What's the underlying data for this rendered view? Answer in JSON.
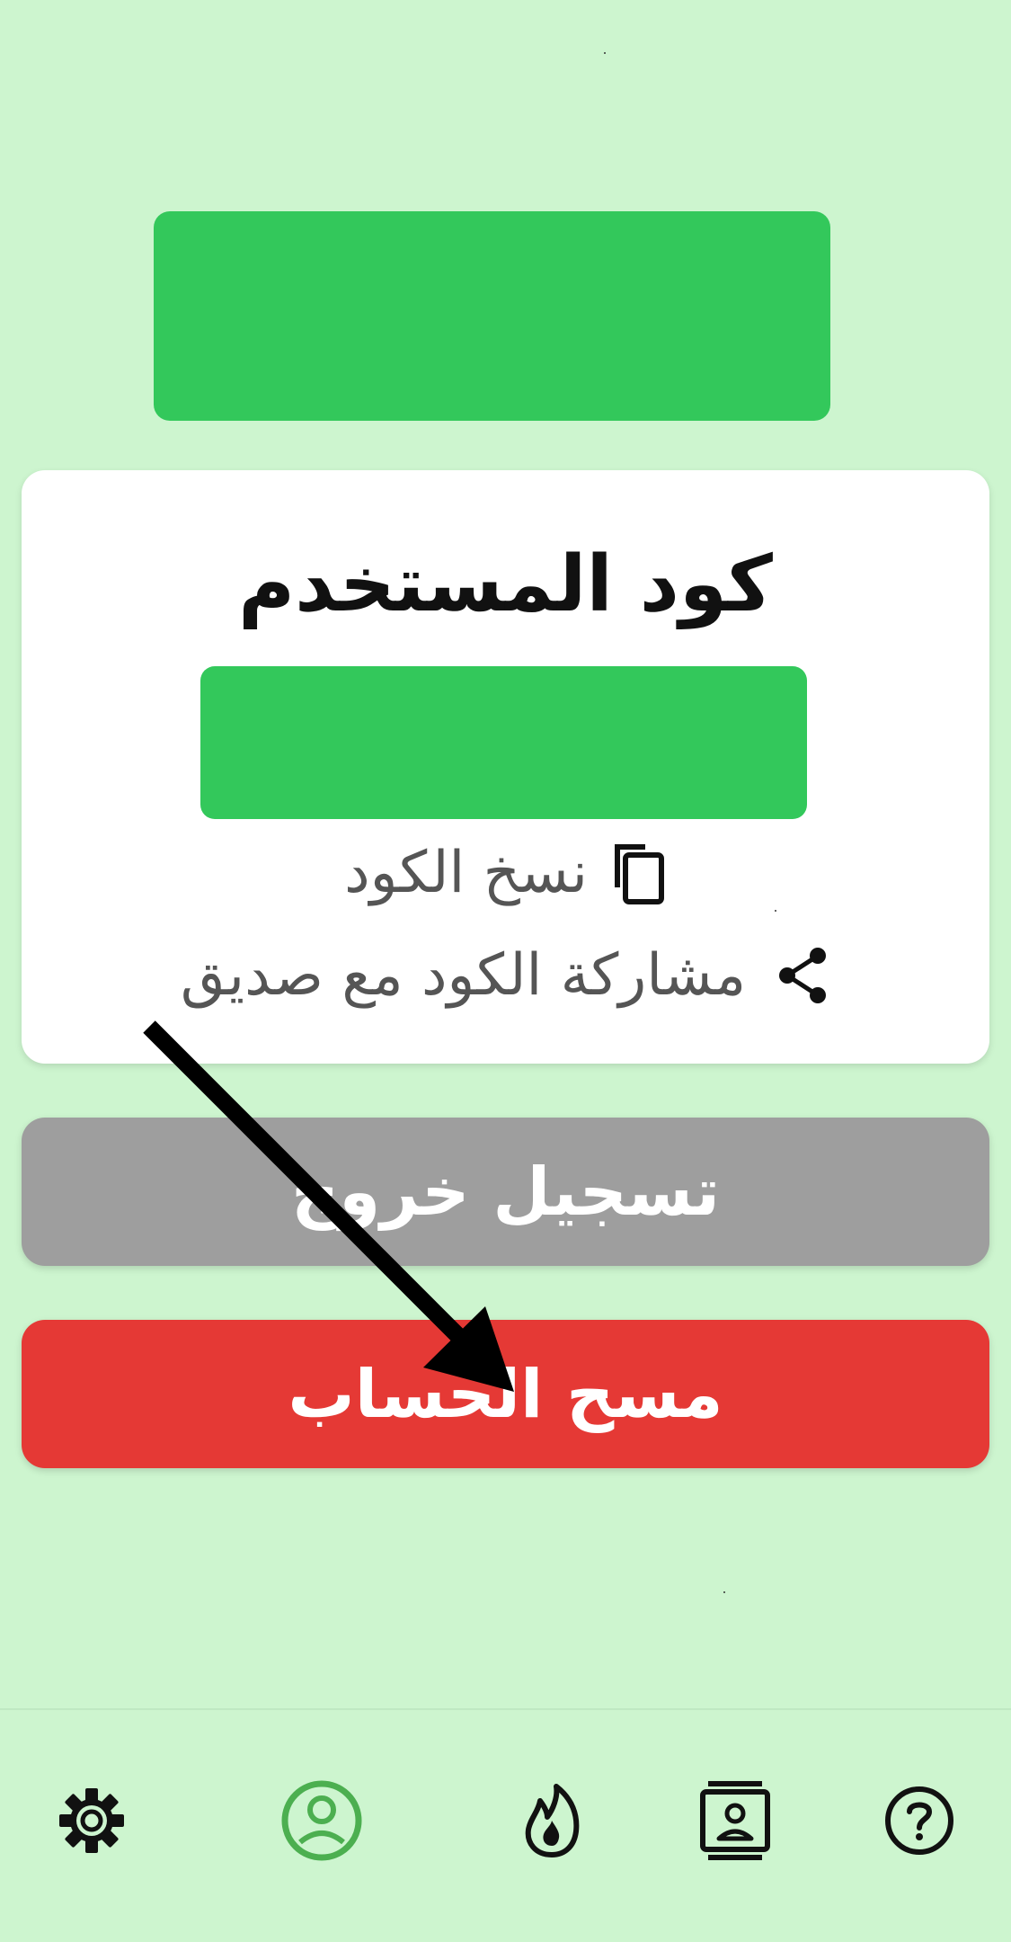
{
  "profile": {
    "user_code_title": "كود المستخدم",
    "copy_code_label": "نسخ الكود",
    "share_code_label": "مشاركة الكود مع صديق"
  },
  "actions": {
    "logout_label": "تسجيل خروج",
    "delete_account_label": "مسح الحساب"
  },
  "bottom_nav": {
    "items": [
      {
        "icon": "help-icon",
        "active": false
      },
      {
        "icon": "contact-card-icon",
        "active": false
      },
      {
        "icon": "flame-icon",
        "active": false
      },
      {
        "icon": "profile-icon",
        "active": true
      },
      {
        "icon": "settings-gear-icon",
        "active": false
      }
    ]
  },
  "colors": {
    "background": "#cdf5cf",
    "brand_green": "#33c85b",
    "logout_gray": "#9e9e9e",
    "delete_red": "#e53935",
    "active_nav": "#4caf50"
  }
}
